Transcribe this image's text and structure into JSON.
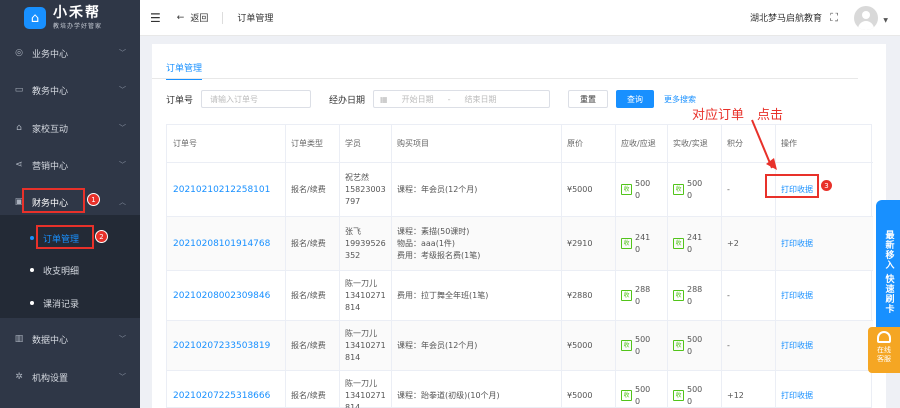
{
  "sidebar": {
    "logo_title": "小禾帮",
    "logo_sub": "教培办学好管家",
    "items": [
      {
        "label": "业务中心",
        "icon": "user-icon"
      },
      {
        "label": "教务中心",
        "icon": "book-icon"
      },
      {
        "label": "家校互动",
        "icon": "home-icon"
      },
      {
        "label": "营销中心",
        "icon": "share-icon"
      },
      {
        "label": "财务中心",
        "icon": "finance-icon"
      },
      {
        "label": "数据中心",
        "icon": "chart-icon"
      },
      {
        "label": "机构设置",
        "icon": "gear-icon"
      }
    ],
    "sub_items": [
      {
        "label": "订单管理"
      },
      {
        "label": "收支明细"
      },
      {
        "label": "课消记录"
      }
    ]
  },
  "topbar": {
    "back_label": "返回",
    "title": "订单管理",
    "org": "湖北梦马启航教育"
  },
  "tabs": [
    "订单管理"
  ],
  "filter": {
    "order_label": "订单号",
    "order_placeholder": "请输入订单号",
    "date_label": "经办日期",
    "start_placeholder": "开始日期",
    "end_placeholder": "结束日期",
    "reset": "重置",
    "query": "查询",
    "more": "更多搜索"
  },
  "table": {
    "headers": [
      "订单号",
      "订单类型",
      "学员",
      "购买项目",
      "原价",
      "应收/应退",
      "实收/实退",
      "积分",
      "操作"
    ],
    "rows": [
      {
        "order_no": "20210210212258101",
        "type": "报名/续费",
        "student": "祝艺然\n15823003\n797",
        "items": "课程：年会员(12个月)",
        "price": "¥5000",
        "due": "500\n0",
        "paid": "500\n0",
        "points": "-",
        "action": "打印收据"
      },
      {
        "order_no": "20210208101914768",
        "type": "报名/续费",
        "student": "张飞\n19939526\n352",
        "items": "课程：素描(50课时)\n物品：aaa(1件)\n费用：考级报名费(1笔)",
        "price": "¥2910",
        "due": "241\n0",
        "paid": "241\n0",
        "points": "+2",
        "action": "打印收据"
      },
      {
        "order_no": "20210208002309846",
        "type": "报名/续费",
        "student": "陈一刀儿\n13410271\n814",
        "items": "费用：拉丁舞全年班(1笔)",
        "price": "¥2880",
        "due": "288\n0",
        "paid": "288\n0",
        "points": "-",
        "action": "打印收据"
      },
      {
        "order_no": "20210207233503819",
        "type": "报名/续费",
        "student": "陈一刀儿\n13410271\n814",
        "items": "课程：年会员(12个月)",
        "price": "¥5000",
        "due": "500\n0",
        "paid": "500\n0",
        "points": "-",
        "action": "打印收据"
      },
      {
        "order_no": "20210207225318666",
        "type": "报名/续费",
        "student": "陈一刀儿\n13410271\n814",
        "items": "课程：跆拳道(初级)(10个月)",
        "price": "¥5000",
        "due": "500\n0",
        "paid": "500\n0",
        "points": "+12",
        "action": "打印收据"
      }
    ],
    "tag_label": "收"
  },
  "annotations": {
    "text1": "对应订单",
    "text2": "点击",
    "badge1": "1",
    "badge2": "2",
    "badge3": "3",
    "color": "#e8312a"
  },
  "float": {
    "service_text": "最新移入 快速刷卡",
    "kf_text": "在线\n客服"
  },
  "colors": {
    "accent": "#1890ff",
    "sidebar": "#2f3747",
    "annotation": "#e8312a",
    "tag": "#52c41a"
  }
}
